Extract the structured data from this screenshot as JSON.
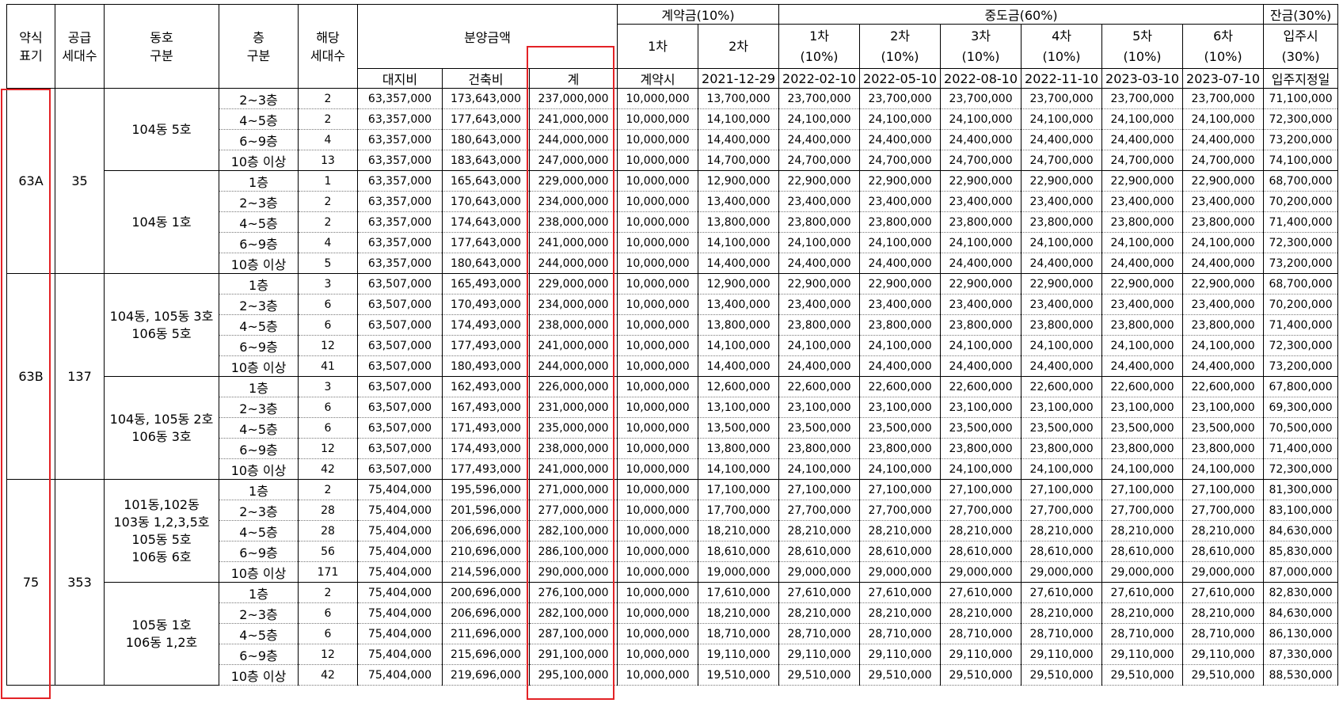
{
  "header": {
    "abbr": "약식\n표기",
    "supply": "공급\n세대수",
    "dong": "동호\n구분",
    "floor": "층\n구분",
    "units": "해당\n세대수",
    "price_group": "분양금액",
    "land": "대지비",
    "building": "건축비",
    "total": "계",
    "contract_group": "계약금(10%)",
    "middle_group": "중도금(60%)",
    "balance_group": "잔금(30%)",
    "installments": [
      {
        "label": "1차",
        "pct": ""
      },
      {
        "label": "2차",
        "pct": ""
      },
      {
        "label": "1차",
        "pct": "(10%)"
      },
      {
        "label": "2차",
        "pct": "(10%)"
      },
      {
        "label": "3차",
        "pct": "(10%)"
      },
      {
        "label": "4차",
        "pct": "(10%)"
      },
      {
        "label": "5차",
        "pct": "(10%)"
      },
      {
        "label": "6차",
        "pct": "(10%)"
      },
      {
        "label": "입주시",
        "pct": "(30%)"
      }
    ],
    "dates": [
      "계약시",
      "2021-12-29",
      "2022-02-10",
      "2022-05-10",
      "2022-08-10",
      "2022-11-10",
      "2023-03-10",
      "2023-07-10",
      "입주지정일"
    ]
  },
  "types": [
    {
      "abbr": "63A",
      "supply": "35",
      "groups": [
        {
          "dong": "104동 5호",
          "rows": [
            [
              "2~3층",
              "2",
              "63,357,000",
              "173,643,000",
              "237,000,000",
              "10,000,000",
              "13,700,000",
              "23,700,000",
              "23,700,000",
              "23,700,000",
              "23,700,000",
              "23,700,000",
              "23,700,000",
              "71,100,000"
            ],
            [
              "4~5층",
              "2",
              "63,357,000",
              "177,643,000",
              "241,000,000",
              "10,000,000",
              "14,100,000",
              "24,100,000",
              "24,100,000",
              "24,100,000",
              "24,100,000",
              "24,100,000",
              "24,100,000",
              "72,300,000"
            ],
            [
              "6~9층",
              "4",
              "63,357,000",
              "180,643,000",
              "244,000,000",
              "10,000,000",
              "14,400,000",
              "24,400,000",
              "24,400,000",
              "24,400,000",
              "24,400,000",
              "24,400,000",
              "24,400,000",
              "73,200,000"
            ],
            [
              "10층 이상",
              "13",
              "63,357,000",
              "183,643,000",
              "247,000,000",
              "10,000,000",
              "14,700,000",
              "24,700,000",
              "24,700,000",
              "24,700,000",
              "24,700,000",
              "24,700,000",
              "24,700,000",
              "74,100,000"
            ]
          ]
        },
        {
          "dong": "104동 1호",
          "rows": [
            [
              "1층",
              "1",
              "63,357,000",
              "165,643,000",
              "229,000,000",
              "10,000,000",
              "12,900,000",
              "22,900,000",
              "22,900,000",
              "22,900,000",
              "22,900,000",
              "22,900,000",
              "22,900,000",
              "68,700,000"
            ],
            [
              "2~3층",
              "2",
              "63,357,000",
              "170,643,000",
              "234,000,000",
              "10,000,000",
              "13,400,000",
              "23,400,000",
              "23,400,000",
              "23,400,000",
              "23,400,000",
              "23,400,000",
              "23,400,000",
              "70,200,000"
            ],
            [
              "4~5층",
              "2",
              "63,357,000",
              "174,643,000",
              "238,000,000",
              "10,000,000",
              "13,800,000",
              "23,800,000",
              "23,800,000",
              "23,800,000",
              "23,800,000",
              "23,800,000",
              "23,800,000",
              "71,400,000"
            ],
            [
              "6~9층",
              "4",
              "63,357,000",
              "177,643,000",
              "241,000,000",
              "10,000,000",
              "14,100,000",
              "24,100,000",
              "24,100,000",
              "24,100,000",
              "24,100,000",
              "24,100,000",
              "24,100,000",
              "72,300,000"
            ],
            [
              "10층 이상",
              "5",
              "63,357,000",
              "180,643,000",
              "244,000,000",
              "10,000,000",
              "14,400,000",
              "24,400,000",
              "24,400,000",
              "24,400,000",
              "24,400,000",
              "24,400,000",
              "24,400,000",
              "73,200,000"
            ]
          ]
        }
      ]
    },
    {
      "abbr": "63B",
      "supply": "137",
      "groups": [
        {
          "dong": "104동, 105동 3호\n106동 5호",
          "rows": [
            [
              "1층",
              "3",
              "63,507,000",
              "165,493,000",
              "229,000,000",
              "10,000,000",
              "12,900,000",
              "22,900,000",
              "22,900,000",
              "22,900,000",
              "22,900,000",
              "22,900,000",
              "22,900,000",
              "68,700,000"
            ],
            [
              "2~3층",
              "6",
              "63,507,000",
              "170,493,000",
              "234,000,000",
              "10,000,000",
              "13,400,000",
              "23,400,000",
              "23,400,000",
              "23,400,000",
              "23,400,000",
              "23,400,000",
              "23,400,000",
              "70,200,000"
            ],
            [
              "4~5층",
              "6",
              "63,507,000",
              "174,493,000",
              "238,000,000",
              "10,000,000",
              "13,800,000",
              "23,800,000",
              "23,800,000",
              "23,800,000",
              "23,800,000",
              "23,800,000",
              "23,800,000",
              "71,400,000"
            ],
            [
              "6~9층",
              "12",
              "63,507,000",
              "177,493,000",
              "241,000,000",
              "10,000,000",
              "14,100,000",
              "24,100,000",
              "24,100,000",
              "24,100,000",
              "24,100,000",
              "24,100,000",
              "24,100,000",
              "72,300,000"
            ],
            [
              "10층 이상",
              "41",
              "63,507,000",
              "180,493,000",
              "244,000,000",
              "10,000,000",
              "14,400,000",
              "24,400,000",
              "24,400,000",
              "24,400,000",
              "24,400,000",
              "24,400,000",
              "24,400,000",
              "73,200,000"
            ]
          ]
        },
        {
          "dong": "104동, 105동 2호\n106동 3호",
          "rows": [
            [
              "1층",
              "3",
              "63,507,000",
              "162,493,000",
              "226,000,000",
              "10,000,000",
              "12,600,000",
              "22,600,000",
              "22,600,000",
              "22,600,000",
              "22,600,000",
              "22,600,000",
              "22,600,000",
              "67,800,000"
            ],
            [
              "2~3층",
              "6",
              "63,507,000",
              "167,493,000",
              "231,000,000",
              "10,000,000",
              "13,100,000",
              "23,100,000",
              "23,100,000",
              "23,100,000",
              "23,100,000",
              "23,100,000",
              "23,100,000",
              "69,300,000"
            ],
            [
              "4~5층",
              "6",
              "63,507,000",
              "171,493,000",
              "235,000,000",
              "10,000,000",
              "13,500,000",
              "23,500,000",
              "23,500,000",
              "23,500,000",
              "23,500,000",
              "23,500,000",
              "23,500,000",
              "70,500,000"
            ],
            [
              "6~9층",
              "12",
              "63,507,000",
              "174,493,000",
              "238,000,000",
              "10,000,000",
              "13,800,000",
              "23,800,000",
              "23,800,000",
              "23,800,000",
              "23,800,000",
              "23,800,000",
              "23,800,000",
              "71,400,000"
            ],
            [
              "10층 이상",
              "42",
              "63,507,000",
              "177,493,000",
              "241,000,000",
              "10,000,000",
              "14,100,000",
              "24,100,000",
              "24,100,000",
              "24,100,000",
              "24,100,000",
              "24,100,000",
              "24,100,000",
              "72,300,000"
            ]
          ]
        }
      ]
    },
    {
      "abbr": "75",
      "supply": "353",
      "groups": [
        {
          "dong": "101동,102동\n103동 1,2,3,5호\n105동 5호\n106동 6호",
          "rows": [
            [
              "1층",
              "2",
              "75,404,000",
              "195,596,000",
              "271,000,000",
              "10,000,000",
              "17,100,000",
              "27,100,000",
              "27,100,000",
              "27,100,000",
              "27,100,000",
              "27,100,000",
              "27,100,000",
              "81,300,000"
            ],
            [
              "2~3층",
              "28",
              "75,404,000",
              "201,596,000",
              "277,000,000",
              "10,000,000",
              "17,700,000",
              "27,700,000",
              "27,700,000",
              "27,700,000",
              "27,700,000",
              "27,700,000",
              "27,700,000",
              "83,100,000"
            ],
            [
              "4~5층",
              "28",
              "75,404,000",
              "206,696,000",
              "282,100,000",
              "10,000,000",
              "18,210,000",
              "28,210,000",
              "28,210,000",
              "28,210,000",
              "28,210,000",
              "28,210,000",
              "28,210,000",
              "84,630,000"
            ],
            [
              "6~9층",
              "56",
              "75,404,000",
              "210,696,000",
              "286,100,000",
              "10,000,000",
              "18,610,000",
              "28,610,000",
              "28,610,000",
              "28,610,000",
              "28,610,000",
              "28,610,000",
              "28,610,000",
              "85,830,000"
            ],
            [
              "10층 이상",
              "171",
              "75,404,000",
              "214,596,000",
              "290,000,000",
              "10,000,000",
              "19,000,000",
              "29,000,000",
              "29,000,000",
              "29,000,000",
              "29,000,000",
              "29,000,000",
              "29,000,000",
              "87,000,000"
            ]
          ]
        },
        {
          "dong": "105동 1호\n106동 1,2호",
          "rows": [
            [
              "1층",
              "2",
              "75,404,000",
              "200,696,000",
              "276,100,000",
              "10,000,000",
              "17,610,000",
              "27,610,000",
              "27,610,000",
              "27,610,000",
              "27,610,000",
              "27,610,000",
              "27,610,000",
              "82,830,000"
            ],
            [
              "2~3층",
              "6",
              "75,404,000",
              "206,696,000",
              "282,100,000",
              "10,000,000",
              "18,210,000",
              "28,210,000",
              "28,210,000",
              "28,210,000",
              "28,210,000",
              "28,210,000",
              "28,210,000",
              "84,630,000"
            ],
            [
              "4~5층",
              "6",
              "75,404,000",
              "211,696,000",
              "287,100,000",
              "10,000,000",
              "18,710,000",
              "28,710,000",
              "28,710,000",
              "28,710,000",
              "28,710,000",
              "28,710,000",
              "28,710,000",
              "86,130,000"
            ],
            [
              "6~9층",
              "12",
              "75,404,000",
              "215,696,000",
              "291,100,000",
              "10,000,000",
              "19,110,000",
              "29,110,000",
              "29,110,000",
              "29,110,000",
              "29,110,000",
              "29,110,000",
              "29,110,000",
              "87,330,000"
            ],
            [
              "10층 이상",
              "42",
              "75,404,000",
              "219,696,000",
              "295,100,000",
              "10,000,000",
              "19,510,000",
              "29,510,000",
              "29,510,000",
              "29,510,000",
              "29,510,000",
              "29,510,000",
              "29,510,000",
              "88,530,000"
            ]
          ]
        }
      ]
    }
  ],
  "colors": {
    "highlight_box": "#e32226",
    "grid": "#000000"
  }
}
